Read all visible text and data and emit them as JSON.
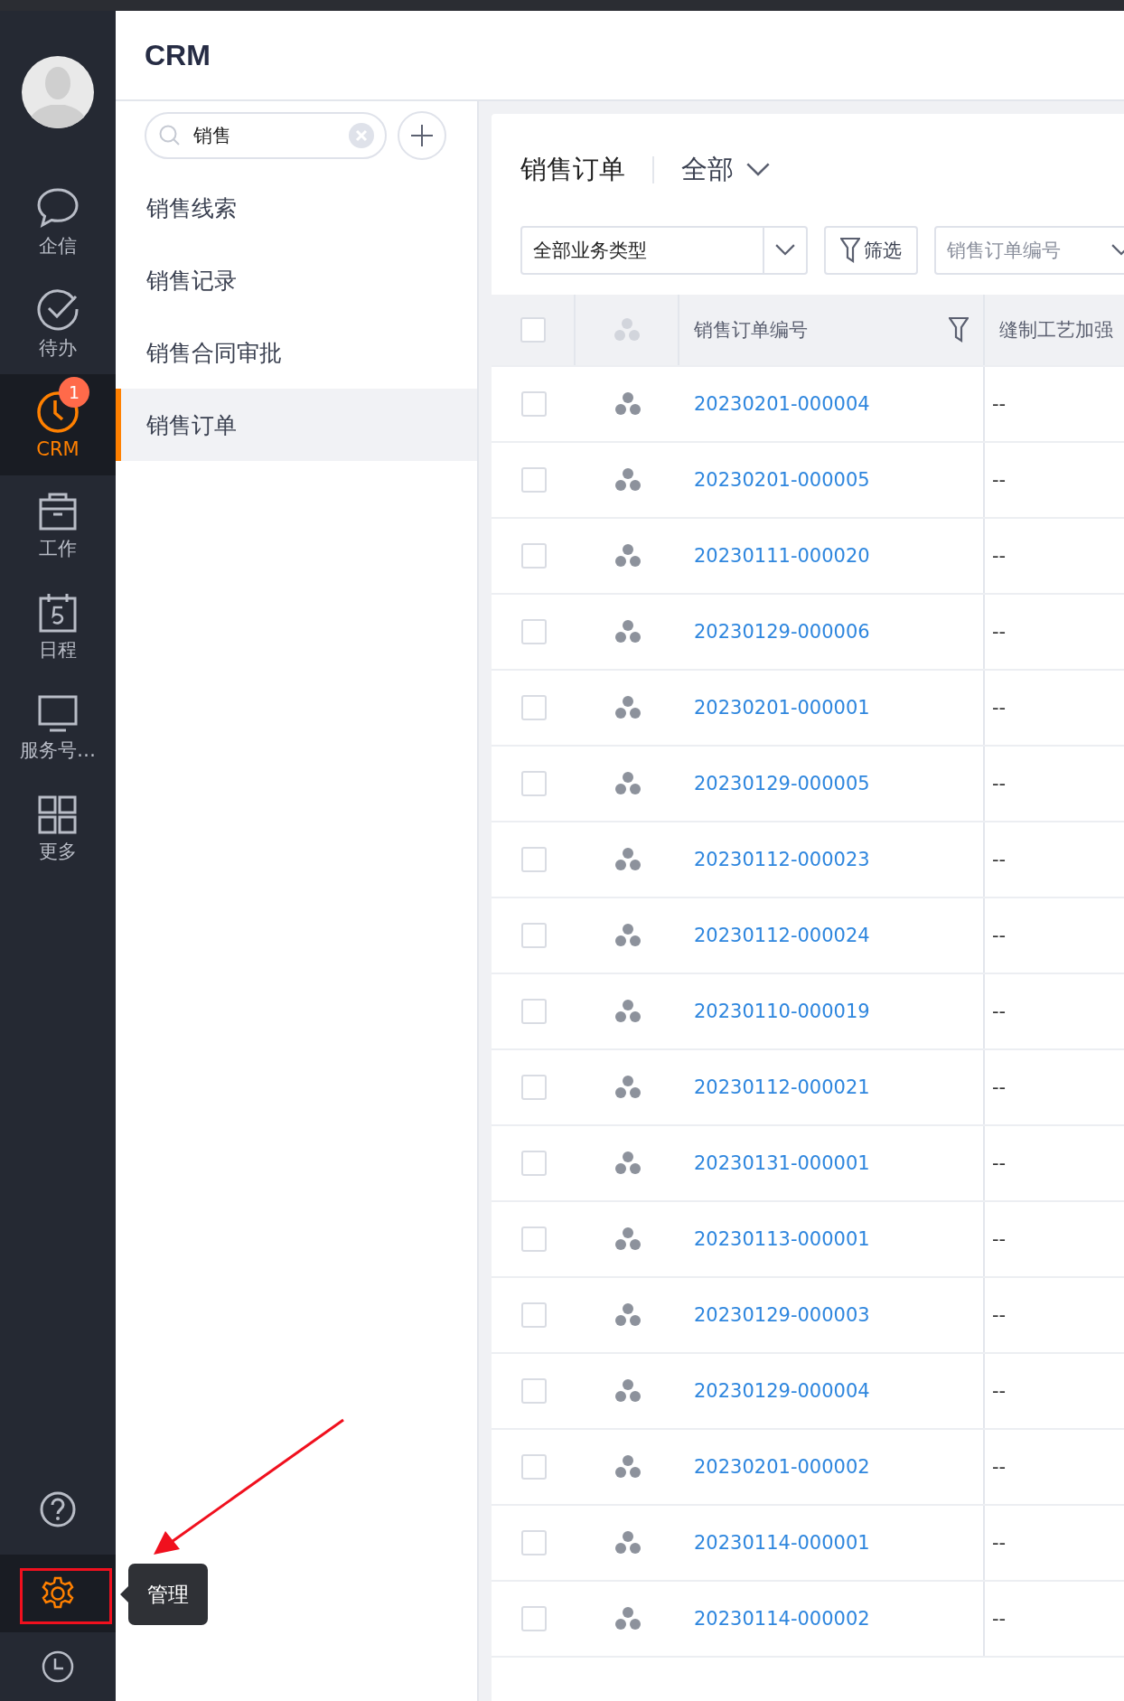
{
  "nav": {
    "items": [
      {
        "label": "企信",
        "selected": false
      },
      {
        "label": "待办",
        "selected": false
      },
      {
        "label": "CRM",
        "selected": true,
        "badge": "1"
      },
      {
        "label": "工作",
        "selected": false
      },
      {
        "label": "日程",
        "selected": false
      },
      {
        "label": "服务号…",
        "selected": false
      },
      {
        "label": "更多",
        "selected": false
      }
    ],
    "bottom": [
      {
        "kind": "help",
        "selected": false
      },
      {
        "kind": "settings",
        "selected": true
      },
      {
        "kind": "history",
        "selected": false
      }
    ],
    "tooltip": "管理"
  },
  "header": {
    "title": "CRM"
  },
  "panel": {
    "search": {
      "value": "销售"
    },
    "items": [
      {
        "label": "销售线索",
        "selected": false
      },
      {
        "label": "销售记录",
        "selected": false
      },
      {
        "label": "销售合同审批",
        "selected": false
      },
      {
        "label": "销售订单",
        "selected": true
      }
    ]
  },
  "main": {
    "title": "销售订单",
    "scope": "全部",
    "type_select": "全部业务类型",
    "filter_button": "筛选",
    "field_select": "销售订单编号",
    "table": {
      "select_all_checked": false,
      "columns": [
        "销售订单编号",
        "缝制工艺加强"
      ],
      "rows": [
        {
          "number": "20230201-000004",
          "column_2": "--",
          "checked": false
        },
        {
          "number": "20230201-000005",
          "column_2": "--",
          "checked": false
        },
        {
          "number": "20230111-000020",
          "column_2": "--",
          "checked": false
        },
        {
          "number": "20230129-000006",
          "column_2": "--",
          "checked": false
        },
        {
          "number": "20230201-000001",
          "column_2": "--",
          "checked": false
        },
        {
          "number": "20230129-000005",
          "column_2": "--",
          "checked": false
        },
        {
          "number": "20230112-000023",
          "column_2": "--",
          "checked": false
        },
        {
          "number": "20230112-000024",
          "column_2": "--",
          "checked": false
        },
        {
          "number": "20230110-000019",
          "column_2": "--",
          "checked": false
        },
        {
          "number": "20230112-000021",
          "column_2": "--",
          "checked": false
        },
        {
          "number": "20230131-000001",
          "column_2": "--",
          "checked": false
        },
        {
          "number": "20230113-000001",
          "column_2": "--",
          "checked": false
        },
        {
          "number": "20230129-000003",
          "column_2": "--",
          "checked": false
        },
        {
          "number": "20230129-000004",
          "column_2": "--",
          "checked": false
        },
        {
          "number": "20230201-000002",
          "column_2": "--",
          "checked": false
        },
        {
          "number": "20230114-000001",
          "column_2": "--",
          "checked": false
        },
        {
          "number": "20230114-000002",
          "column_2": "--",
          "checked": false
        }
      ]
    }
  }
}
